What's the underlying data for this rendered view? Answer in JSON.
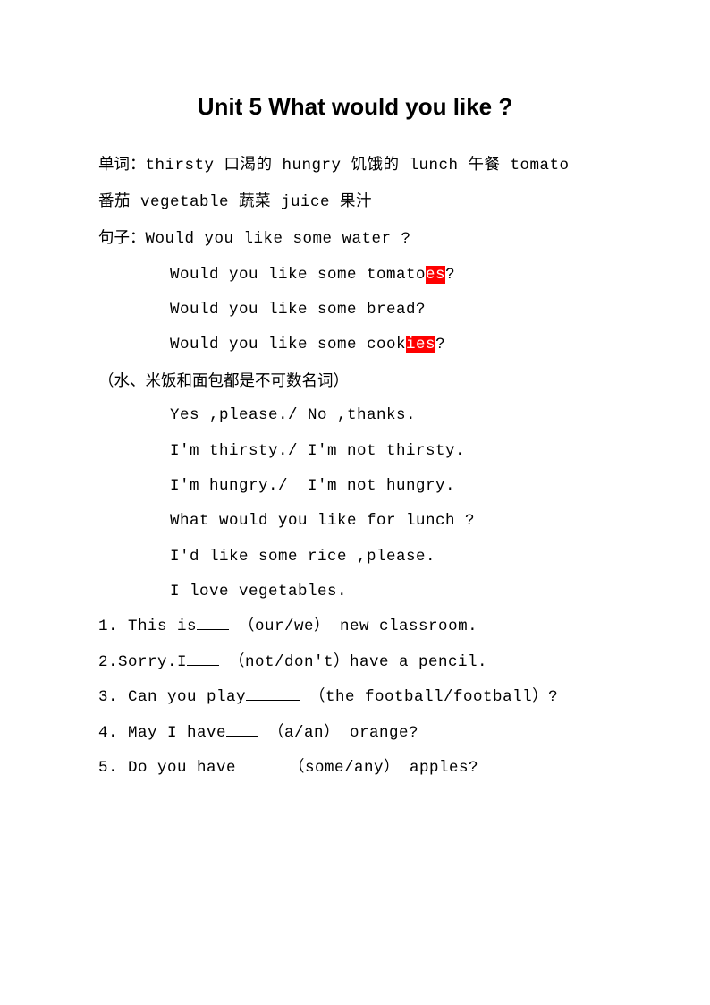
{
  "title": "Unit 5 What would you like ?",
  "vocab": {
    "label": "单词：",
    "line1": "thirsty 口渴的 hungry 饥饿的 lunch 午餐 tomato",
    "line2": "番茄 vegetable 蔬菜 juice 果汁"
  },
  "sentences": {
    "label": "句子：",
    "s1": "Would you like some water ?",
    "s2a": "Would you like some tomato",
    "s2hl": "es",
    "s2b": "?",
    "s3": "Would you like some bread?",
    "s4a": "Would you like some cook",
    "s4hl": "ies",
    "s4b": "?",
    "note": "（水、米饭和面包都是不可数名词）",
    "s5": "Yes ,please./ No ,thanks.",
    "s6": "I'm thirsty./ I'm not thirsty.",
    "s7": "I'm hungry./  I'm not hungry.",
    "s8": "What would you like for lunch ?",
    "s9": "I'd like some rice ,please.",
    "s10": "I love vegetables."
  },
  "exercises": {
    "q1a": "1. This is",
    "q1b": " （our/we） new classroom.",
    "q2a": "2.Sorry.I",
    "q2b": " （not/don't）have a pencil.",
    "q3a": "3. Can you play",
    "q3b": " （the football/football）?",
    "q4a": "4. May I have",
    "q4b": " （a/an） orange?",
    "q5a": "5. Do you have",
    "q5b": " （some/any） apples?"
  }
}
